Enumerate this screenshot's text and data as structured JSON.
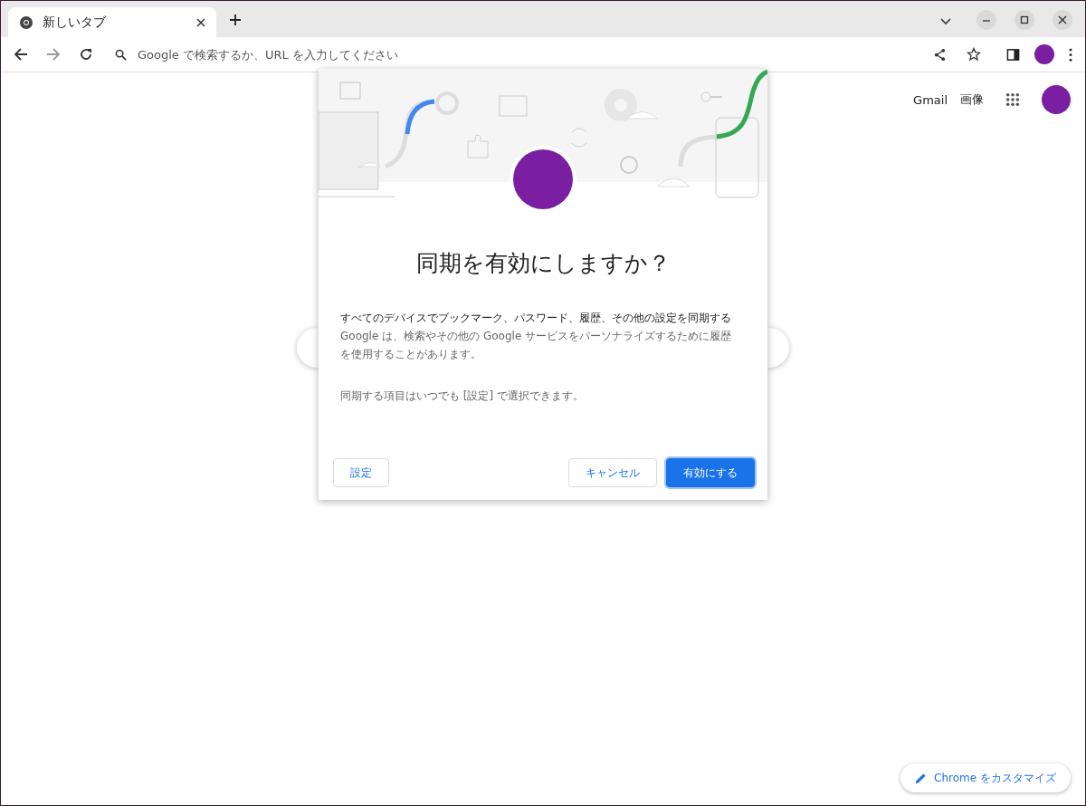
{
  "tab": {
    "title": "新しいタブ",
    "selected": true
  },
  "toolbar": {
    "omnibox": {
      "placeholder": "Google で検索するか、URL を入力してください"
    }
  },
  "page": {
    "header_links": [
      "Gmail",
      "画像"
    ],
    "customize_button": "Chrome をカスタマイズ"
  },
  "dialog": {
    "title": "同期を有効にしますか？",
    "description": "すべてのデバイスでブックマーク、パスワード、履歴、その他の設定を同期する",
    "detail": "Google は、検索やその他の Google サービスをパーソナライズするために履歴を使用することがあります。",
    "note": "同期する項目はいつでも [設定] で選択できます。",
    "buttons": [
      {
        "label": "設定",
        "kind": "secondary"
      },
      {
        "label": "キャンセル",
        "kind": "secondary"
      },
      {
        "label": "有効にする",
        "kind": "primary"
      }
    ]
  }
}
